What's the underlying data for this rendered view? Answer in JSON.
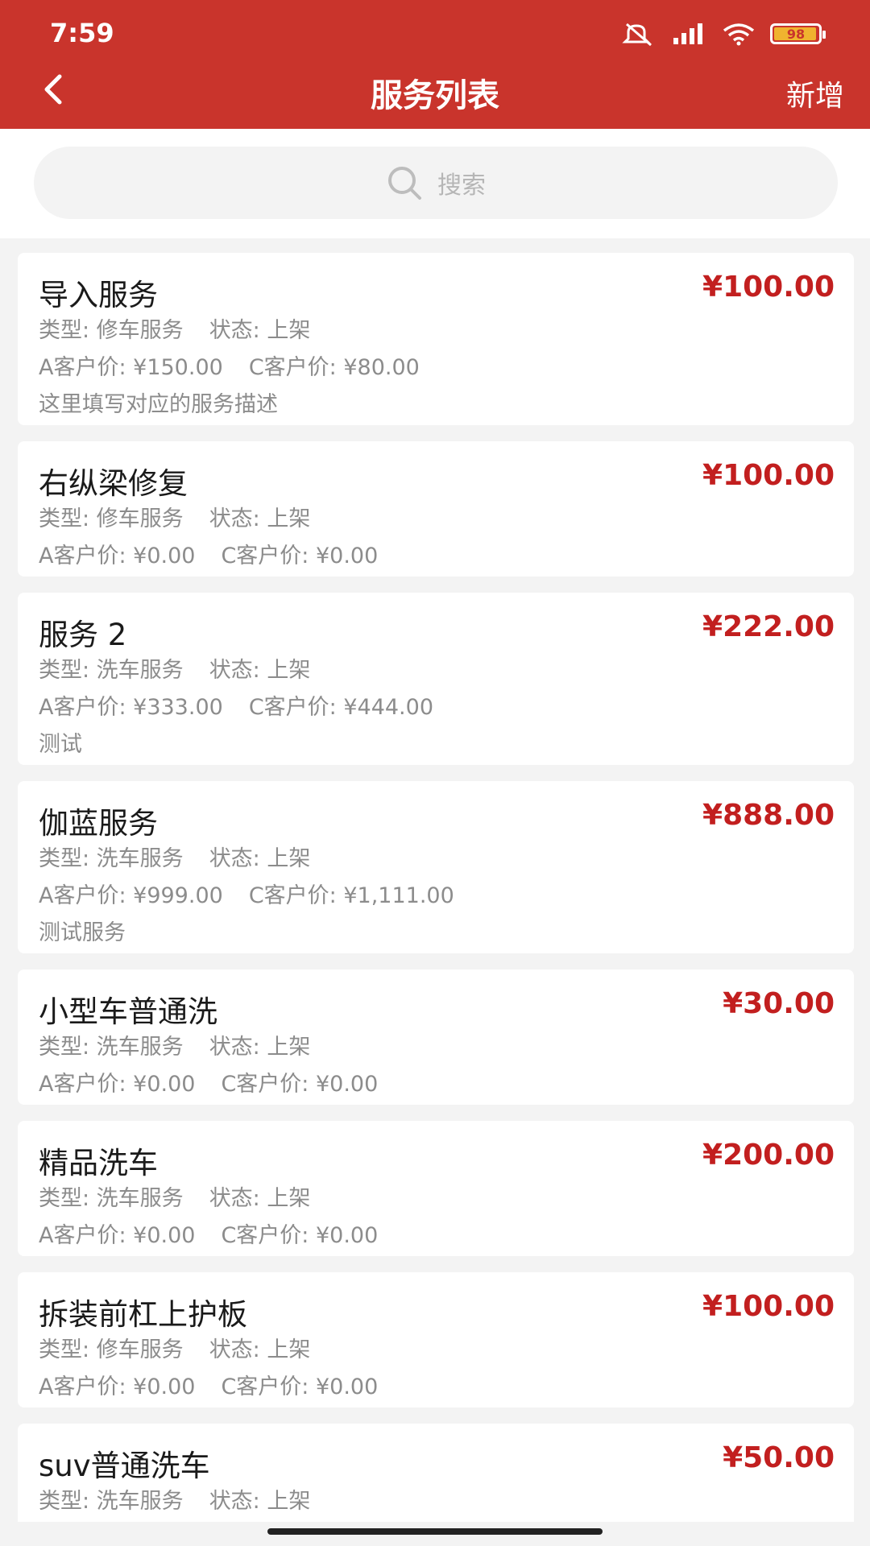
{
  "status_bar": {
    "time": "7:59",
    "battery": "98"
  },
  "header": {
    "title": "服务列表",
    "add_label": "新增"
  },
  "search": {
    "placeholder": "搜索"
  },
  "services": [
    {
      "name": "导入服务",
      "price": "¥100.00",
      "type": "类型: 修车服务",
      "status": "状态: 上架",
      "a_price": "A客户价: ¥150.00",
      "c_price": "C客户价: ¥80.00",
      "desc": "这里填写对应的服务描述"
    },
    {
      "name": "右纵梁修复",
      "price": "¥100.00",
      "type": "类型: 修车服务",
      "status": "状态: 上架",
      "a_price": "A客户价: ¥0.00",
      "c_price": "C客户价: ¥0.00",
      "desc": ""
    },
    {
      "name": "服务 2",
      "price": "¥222.00",
      "type": "类型: 洗车服务",
      "status": "状态: 上架",
      "a_price": "A客户价: ¥333.00",
      "c_price": "C客户价: ¥444.00",
      "desc": "测试"
    },
    {
      "name": "伽蓝服务",
      "price": "¥888.00",
      "type": "类型: 洗车服务",
      "status": "状态: 上架",
      "a_price": "A客户价: ¥999.00",
      "c_price": "C客户价: ¥1,111.00",
      "desc": "测试服务"
    },
    {
      "name": "小型车普通洗",
      "price": "¥30.00",
      "type": "类型: 洗车服务",
      "status": "状态: 上架",
      "a_price": "A客户价: ¥0.00",
      "c_price": "C客户价: ¥0.00",
      "desc": ""
    },
    {
      "name": "精品洗车",
      "price": "¥200.00",
      "type": "类型: 洗车服务",
      "status": "状态: 上架",
      "a_price": "A客户价: ¥0.00",
      "c_price": "C客户价: ¥0.00",
      "desc": ""
    },
    {
      "name": "拆装前杠上护板",
      "price": "¥100.00",
      "type": "类型: 修车服务",
      "status": "状态: 上架",
      "a_price": "A客户价: ¥0.00",
      "c_price": "C客户价: ¥0.00",
      "desc": ""
    },
    {
      "name": "suv普通洗车",
      "price": "¥50.00",
      "type": "类型: 洗车服务",
      "status": "状态: 上架",
      "a_price": "",
      "c_price": "",
      "desc": ""
    }
  ],
  "colors": {
    "header_bg": "#c9342c",
    "price": "#c21f1f",
    "meta_text": "#8c8c8c"
  }
}
